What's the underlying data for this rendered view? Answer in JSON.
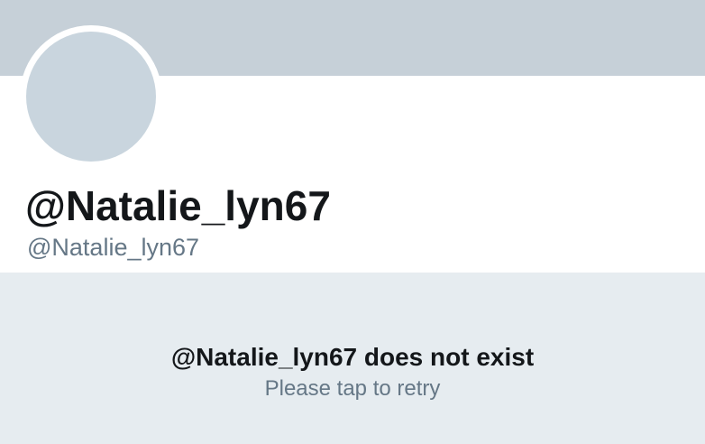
{
  "profile": {
    "display_name": "@Natalie_lyn67",
    "handle": "@Natalie_lyn67"
  },
  "error": {
    "message": "@Natalie_lyn67 does not exist",
    "retry_label": "Please tap to retry"
  },
  "colors": {
    "banner": "#c6d0d8",
    "avatar_placeholder": "#c9d5de",
    "panel_background": "#e6ecf0",
    "primary_text": "#14171a",
    "secondary_text": "#657786"
  }
}
